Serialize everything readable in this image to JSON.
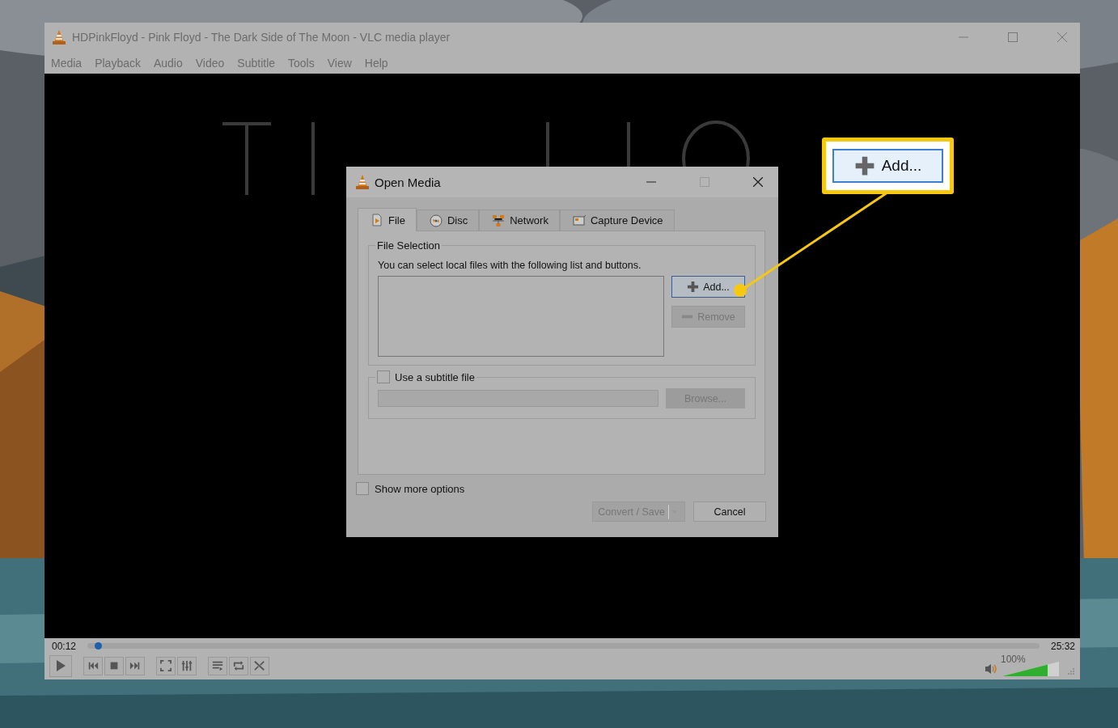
{
  "window": {
    "title": "HDPinkFloyd - Pink Floyd - The Dark Side of The Moon - VLC media player"
  },
  "menu": [
    "Media",
    "Playback",
    "Audio",
    "Video",
    "Subtitle",
    "Tools",
    "View",
    "Help"
  ],
  "player": {
    "elapsed": "00:12",
    "total": "25:32",
    "level": 0.008,
    "volume": {
      "reading": "100%",
      "level": 0.8
    }
  },
  "dialog": {
    "title": "Open Media",
    "tabs": [
      {
        "label": "File",
        "selected": true,
        "kind": "file"
      },
      {
        "label": "Disc",
        "selected": false,
        "kind": "disc"
      },
      {
        "label": "Network",
        "selected": false,
        "kind": "network"
      },
      {
        "label": "Capture Device",
        "selected": false,
        "kind": "capture"
      }
    ],
    "file_selection": {
      "legend": "File Selection",
      "hint": "You can select local files with the following list and buttons.",
      "buttons": [
        {
          "label": "Add...",
          "kind": "add",
          "disabled": false,
          "focused": true
        },
        {
          "label": "Remove",
          "kind": "remove",
          "disabled": true,
          "focused": false
        }
      ]
    },
    "subtitle": {
      "label": "Use a subtitle file",
      "checked": false,
      "browse": "Browse..."
    },
    "show_more": {
      "label": "Show more options",
      "checked": false
    },
    "buttons": [
      {
        "label": "Convert / Save",
        "disabled": true,
        "menu": true
      },
      {
        "label": "Cancel",
        "disabled": false,
        "menu": false
      }
    ]
  },
  "callout": {
    "label": "Add..."
  }
}
